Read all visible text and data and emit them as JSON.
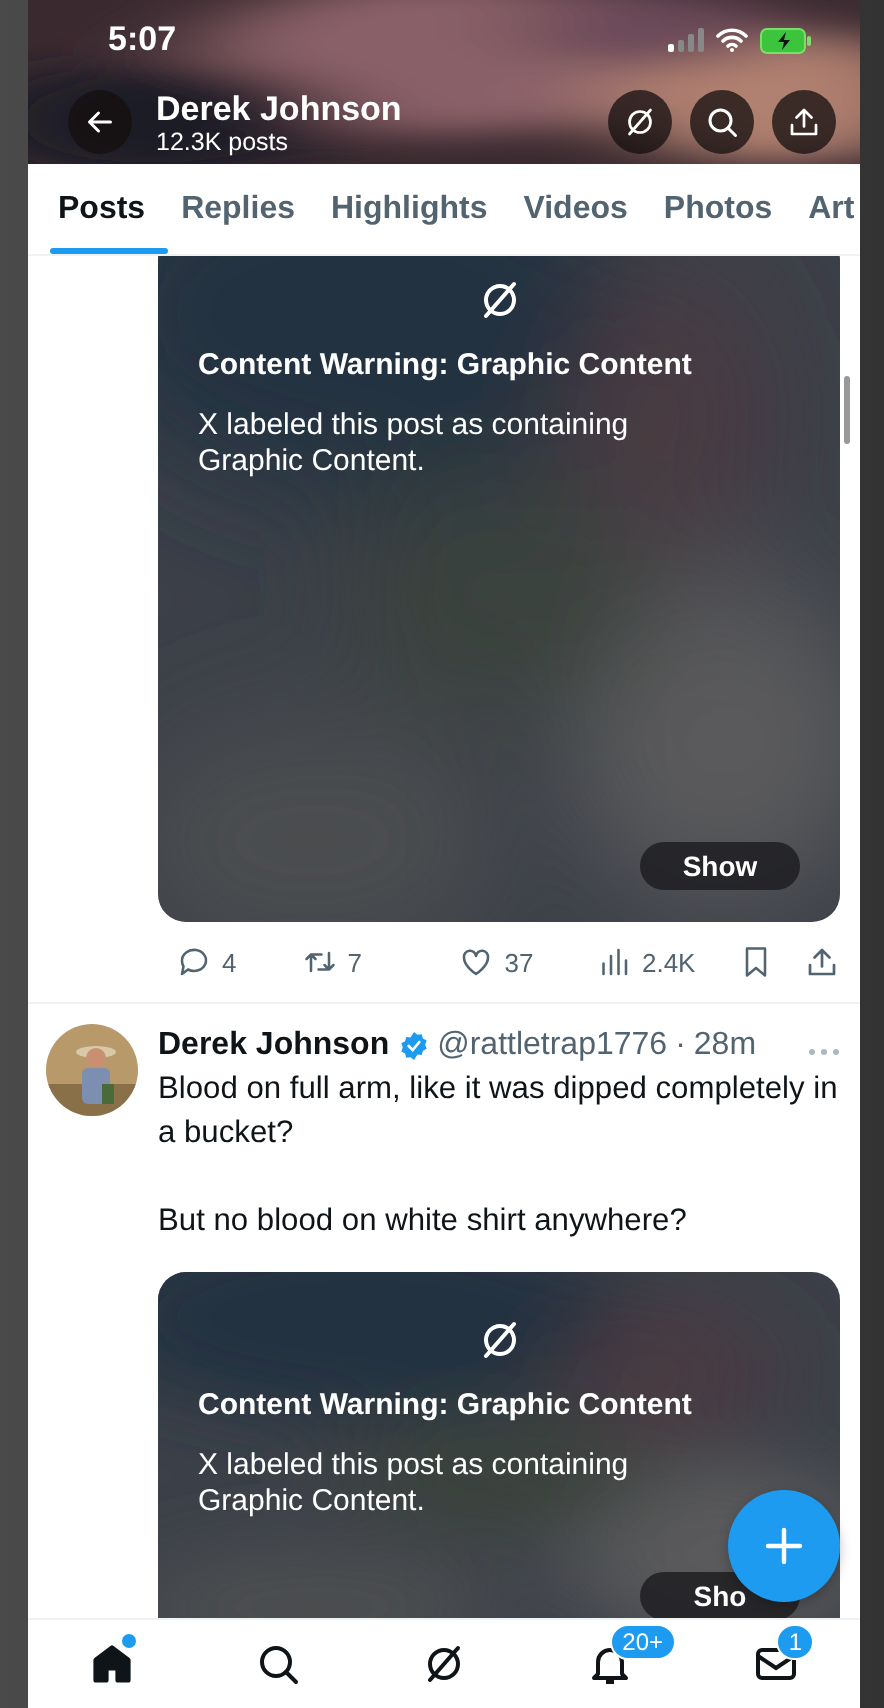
{
  "status_bar": {
    "time": "5:07"
  },
  "header": {
    "title": "Derek Johnson",
    "subtitle": "12.3K posts"
  },
  "tabs": [
    {
      "label": "Posts",
      "selected": true
    },
    {
      "label": "Replies",
      "selected": false
    },
    {
      "label": "Highlights",
      "selected": false
    },
    {
      "label": "Videos",
      "selected": false
    },
    {
      "label": "Photos",
      "selected": false
    },
    {
      "label": "Art",
      "selected": false
    }
  ],
  "posts": [
    {
      "warning": {
        "title": "Content Warning: Graphic Content",
        "body": "X labeled this post as containing Graphic Content.",
        "show": "Show"
      },
      "actions": {
        "replies": "4",
        "reposts": "7",
        "likes": "37",
        "views": "2.4K"
      }
    },
    {
      "author": {
        "name": "Derek Johnson",
        "verified": true,
        "handle": "@rattletrap1776",
        "separator": "·",
        "time": "28m"
      },
      "text": [
        "Blood on full arm, like it was dipped completely in a bucket?",
        "But no blood on white shirt anywhere?"
      ],
      "warning": {
        "title": "Content Warning: Graphic Content",
        "body": "X labeled this post as containing Graphic Content.",
        "show": "Sho"
      }
    }
  ],
  "nav": [
    {
      "kind": "home",
      "selected": true,
      "dot": true
    },
    {
      "kind": "search",
      "selected": false,
      "dot": false
    },
    {
      "kind": "grok",
      "selected": false,
      "dot": false
    },
    {
      "kind": "notifications",
      "selected": false,
      "dot": false,
      "badge": "20+"
    },
    {
      "kind": "messages",
      "selected": false,
      "dot": false,
      "badge": "1"
    }
  ]
}
